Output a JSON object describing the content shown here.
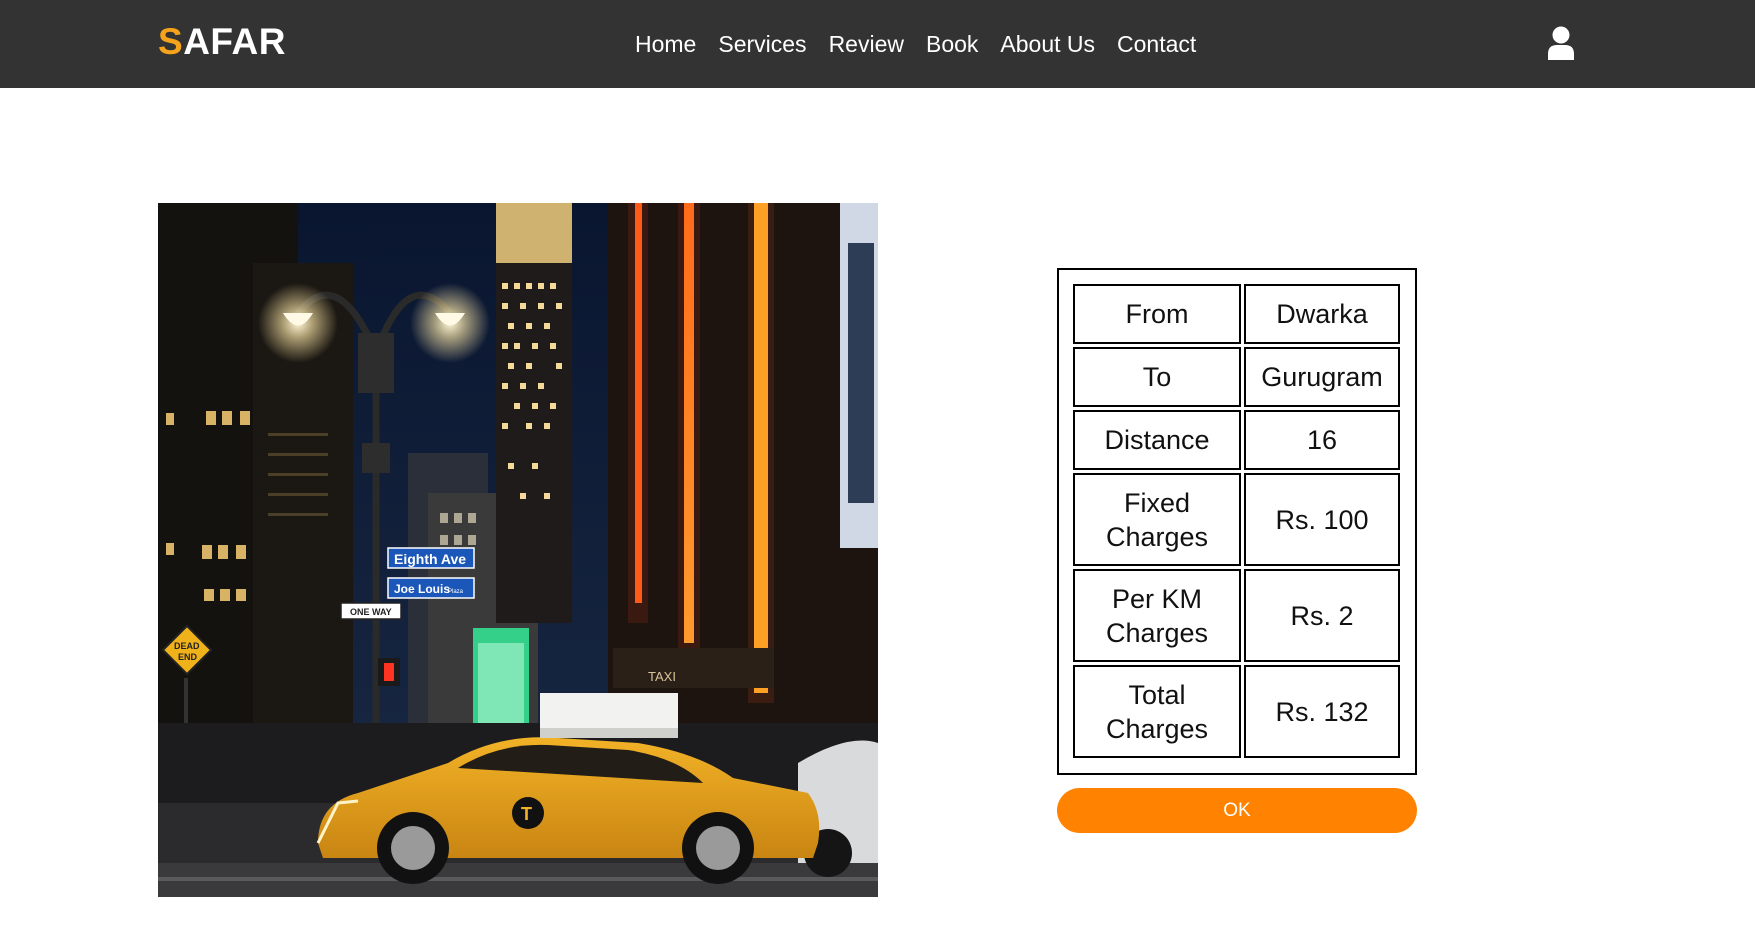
{
  "brand": {
    "first_letter": "S",
    "rest": "AFAR",
    "accent_color": "#f5a31a"
  },
  "nav": {
    "items": [
      {
        "label": "Home"
      },
      {
        "label": "Services"
      },
      {
        "label": "Review"
      },
      {
        "label": "Book"
      },
      {
        "label": "About Us"
      },
      {
        "label": "Contact"
      }
    ],
    "user_icon": "user-icon"
  },
  "hero": {
    "image": "city-night-taxi-photo",
    "street_sign_1": "Eighth Ave",
    "street_sign_2": "Joe Louis",
    "street_sign_2_small": "Plaza",
    "one_way_sign": "ONE WAY",
    "dead_end_sign_1": "DEAD",
    "dead_end_sign_2": "END",
    "taxi_sign": "TAXI",
    "taxi_logo": "T"
  },
  "fare": {
    "rows": [
      {
        "label": "From",
        "value": "Dwarka"
      },
      {
        "label": "To",
        "value": "Gurugram"
      },
      {
        "label": "Distance",
        "value": "16"
      },
      {
        "label_line1": "Fixed",
        "label_line2": "Charges",
        "value": "Rs. 100"
      },
      {
        "label_line1": "Per KM",
        "label_line2": "Charges",
        "value": "Rs. 2"
      },
      {
        "label_line1": "Total",
        "label_line2": "Charges",
        "value": "Rs. 132"
      }
    ]
  },
  "ok_button": {
    "label": "OK",
    "color": "#ff8200"
  }
}
